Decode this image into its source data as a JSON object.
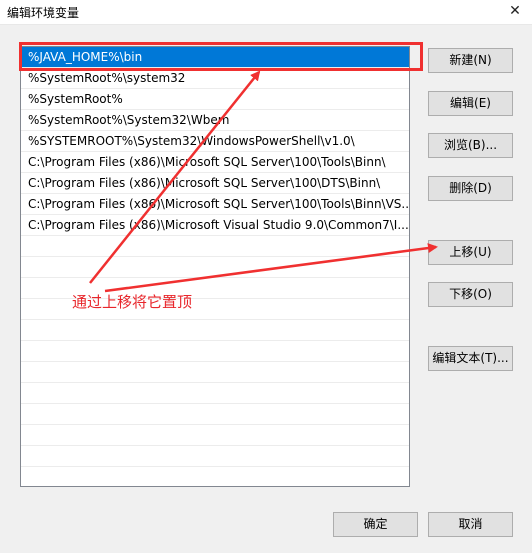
{
  "window": {
    "title": "编辑环境变量",
    "close_glyph": "✕"
  },
  "paths": [
    "%JAVA_HOME%\\bin",
    "%SystemRoot%\\system32",
    "%SystemRoot%",
    "%SystemRoot%\\System32\\Wbem",
    "%SYSTEMROOT%\\System32\\WindowsPowerShell\\v1.0\\",
    "C:\\Program Files (x86)\\Microsoft SQL Server\\100\\Tools\\Binn\\",
    "C:\\Program Files (x86)\\Microsoft SQL Server\\100\\DTS\\Binn\\",
    "C:\\Program Files (x86)\\Microsoft SQL Server\\100\\Tools\\Binn\\VS...",
    "C:\\Program Files (x86)\\Microsoft Visual Studio 9.0\\Common7\\I..."
  ],
  "selected_index": 0,
  "buttons": {
    "new": "新建(N)",
    "edit": "编辑(E)",
    "browse": "浏览(B)...",
    "delete": "删除(D)",
    "move_up": "上移(U)",
    "move_down": "下移(O)",
    "edit_text": "编辑文本(T)...",
    "ok": "确定",
    "cancel": "取消"
  },
  "annotation": {
    "text": "通过上移将它置顶",
    "color": "#e8262b"
  },
  "colors": {
    "selection": "#0078d7",
    "highlight": "#f03030"
  }
}
